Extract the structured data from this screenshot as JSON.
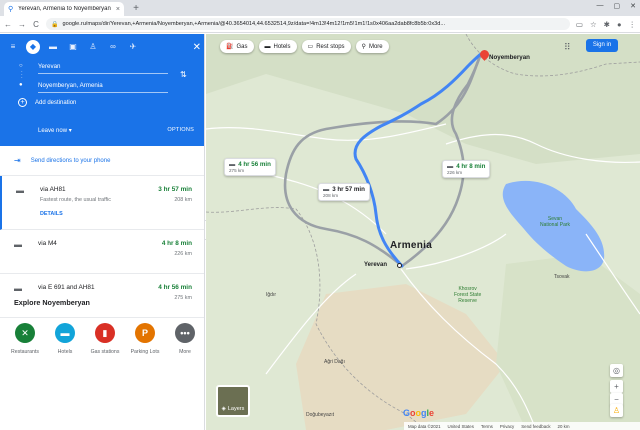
{
  "browser": {
    "tab_title": "Yerevan, Armenia to Noyemberyan",
    "tab_close": "×",
    "new_tab": "+",
    "url": "google.ru/maps/dir/Yerevan,+Armenia/Noyemberyan,+Armenia/@40.3654014,44.6532514,9z/data=!4m13!4m12!1m5!1m1!1s0x406aa2dab8fc8b5b:0x3d...",
    "back": "←",
    "forward": "→",
    "reload": "C",
    "icons": [
      "cast-icon",
      "star-icon",
      "extensions-icon",
      "profile-icon",
      "menu-icon"
    ]
  },
  "directions": {
    "origin": "Yerevan",
    "destination": "Noyemberyan, Armenia",
    "add_destination": "Add destination",
    "leave_now": "Leave now ▾",
    "options": "OPTIONS",
    "send_to_phone": "Send directions to your phone",
    "close": "✕"
  },
  "routes": [
    {
      "via": "via AH81",
      "sub": "Fastest route, the usual traffic",
      "details": "DETAILS",
      "time": "3 hr 57 min",
      "dist": "208 km"
    },
    {
      "via": "via M4",
      "time": "4 hr 8 min",
      "dist": "226 km"
    },
    {
      "via": "via E 691 and AH81",
      "time": "4 hr 56 min",
      "dist": "275 km"
    }
  ],
  "explore": {
    "title": "Explore Noyemberyan",
    "categories": [
      {
        "label": "Restaurants",
        "color": "#188038",
        "glyph": "🍴"
      },
      {
        "label": "Hotels",
        "color": "#12a4d9",
        "glyph": "▬"
      },
      {
        "label": "Gas stations",
        "color": "#d93025",
        "glyph": "⛽"
      },
      {
        "label": "Parking Lots",
        "color": "#e37400",
        "glyph": "P"
      },
      {
        "label": "More",
        "color": "#5f6368",
        "glyph": "•••"
      }
    ]
  },
  "map": {
    "chips": [
      {
        "icon": "gas-icon",
        "glyph": "⛽",
        "label": "Gas"
      },
      {
        "icon": "hotel-icon",
        "glyph": "▬",
        "label": "Hotels"
      },
      {
        "icon": "rest-stop-icon",
        "glyph": "▭",
        "label": "Rest stops"
      },
      {
        "icon": "search-icon",
        "glyph": "⚲",
        "label": "More"
      }
    ],
    "sign_in": "Sign in",
    "route_labels": {
      "best": {
        "time": "3 hr 57 min",
        "dist": "208 km"
      },
      "alt1": {
        "time": "4 hr 8 min",
        "dist": "226 km"
      },
      "alt2": {
        "time": "4 hr 56 min",
        "dist": "275 km"
      }
    },
    "country": "Armenia",
    "origin_label": "Yerevan",
    "destination_label": "Noyemberyan",
    "places": {
      "sevan": "Sevan\nNational Park",
      "khosrov": "Khosrov\nForest State\nReserve",
      "agri": "Ağri Dağı",
      "dogubeyazit": "Doğubeyazıt",
      "igdir": "Iğdır",
      "tsovak": "Tsovak"
    },
    "layers": "Layers",
    "footer": [
      "Map data ©2021",
      "United States",
      "Terms",
      "Privacy",
      "Send feedback",
      "20 km"
    ],
    "zoom_in": "+",
    "zoom_out": "−",
    "locate": "◎"
  },
  "colors": {
    "accent": "#1a73e8",
    "route_primary": "#4285f4",
    "route_alt": "#9aa0a6",
    "time_green": "#188038",
    "lake": "#8ab4f8"
  }
}
